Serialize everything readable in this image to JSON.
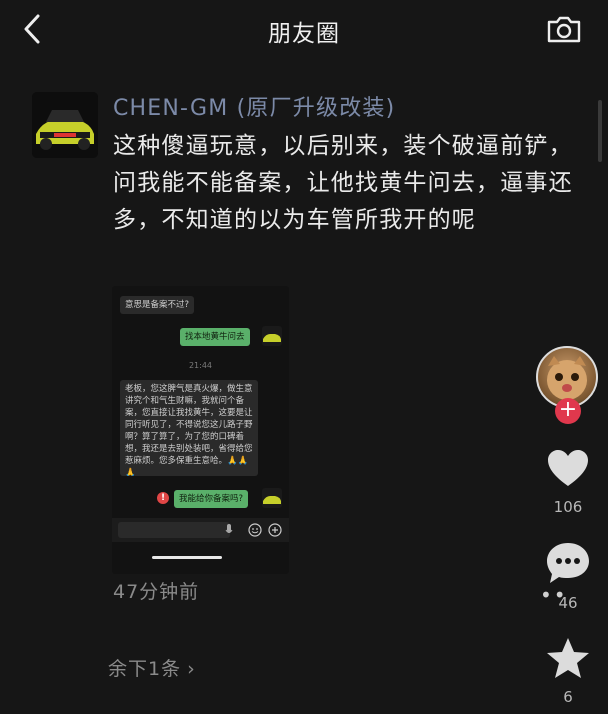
{
  "header": {
    "title": "朋友圈"
  },
  "post": {
    "username": "CHEN-GM (原厂升级改装)",
    "text": "这种傻逼玩意，以后别来，装个破逼前铲，问我能不能备案，让他找黄牛问去，逼事还多，不知道的以为车管所我开的呢",
    "time": "47分钟前"
  },
  "screenshot": {
    "msg1": "意思是备案不过?",
    "msg2": "找本地黄牛问去",
    "time": "21:44",
    "msg3": "老板，您这脾气是真火爆，做生意讲究个和气生财嘛，我就问个备案，您直接让我找黄牛，这要是让同行听见了，不得说您这儿路子野啊？算了算了，为了您的口碑着想，我还是去别处装吧，省得给您惹麻烦。您多保重生意哈。🙏🙏🙏",
    "msg4": "我能给你备案吗?"
  },
  "sidebar": {
    "likes": "106",
    "comments": "46",
    "favorites": "6"
  },
  "footer": {
    "more_label": "余下1条"
  },
  "colors": {
    "username": "#7c8aa8",
    "bg": "#161616",
    "plus": "#e0384d",
    "out_bubble": "#5ab06a"
  }
}
